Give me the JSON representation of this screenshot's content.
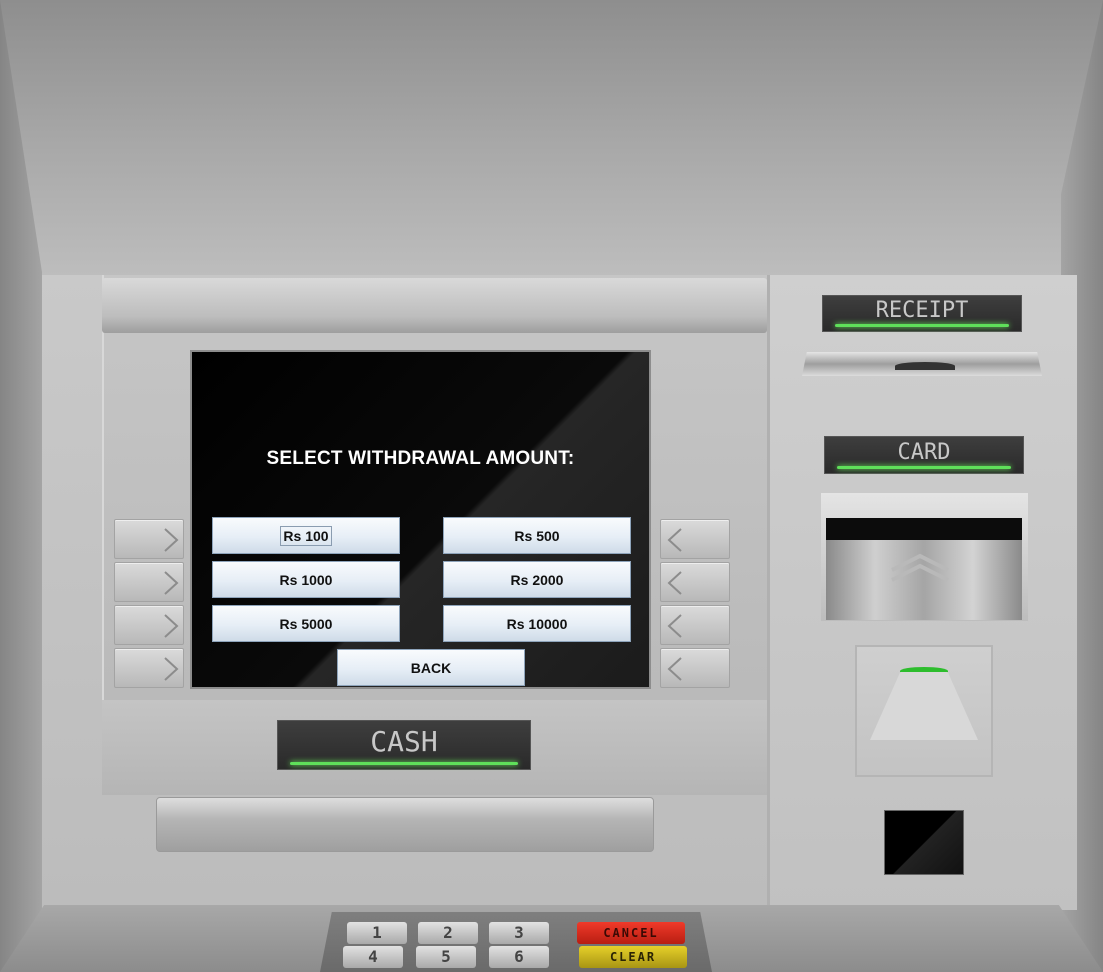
{
  "screen": {
    "title": "SELECT WITHDRAWAL AMOUNT:",
    "amount_buttons": [
      "Rs 100",
      "Rs 500",
      "Rs 1000",
      "Rs 2000",
      "Rs 5000",
      "Rs 10000"
    ],
    "back_label": "BACK"
  },
  "labels": {
    "receipt": "RECEIPT",
    "card": "CARD",
    "cash": "CASH"
  },
  "keypad": {
    "keys": [
      "1",
      "2",
      "3",
      "4",
      "5",
      "6"
    ],
    "cancel": "CANCEL",
    "clear": "CLEAR"
  },
  "colors": {
    "indicator_glow": "#5fe05a",
    "cancel_key": "#e02a1c",
    "clear_key": "#d8c21a"
  }
}
